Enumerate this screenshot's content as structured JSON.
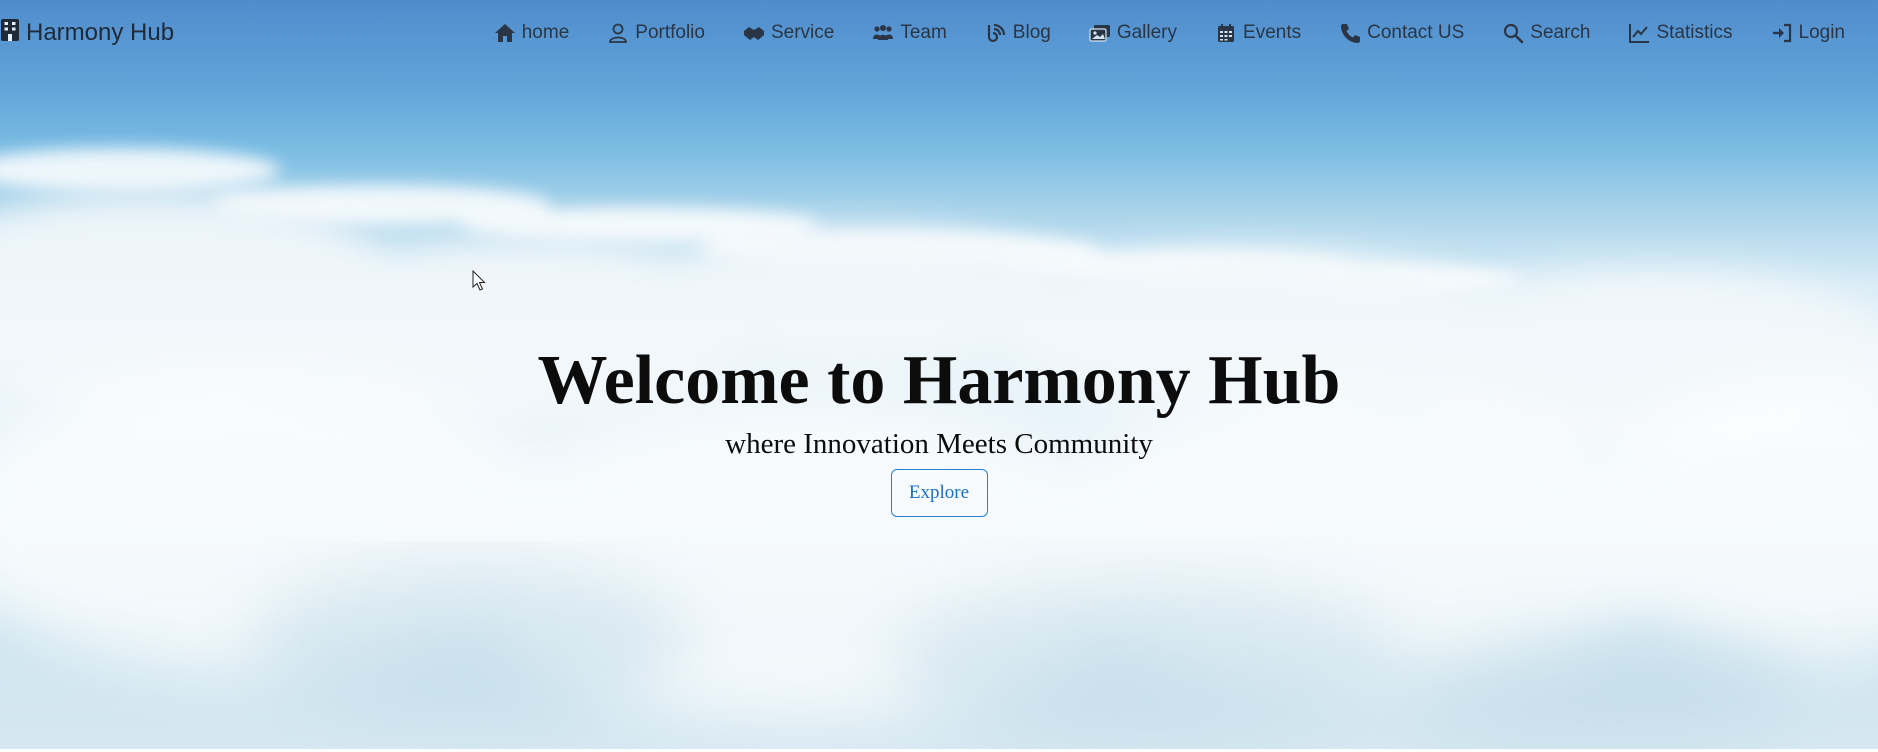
{
  "brand": {
    "icon": "building-icon",
    "name": "Harmony Hub"
  },
  "nav": {
    "items": [
      {
        "icon": "house-icon",
        "label": "home"
      },
      {
        "icon": "user-icon",
        "label": "Portfolio"
      },
      {
        "icon": "handshake-icon",
        "label": "Service"
      },
      {
        "icon": "people-group-icon",
        "label": "Team"
      },
      {
        "icon": "blog-icon",
        "label": "Blog"
      },
      {
        "icon": "images-icon",
        "label": "Gallery"
      },
      {
        "icon": "calendar-icon",
        "label": "Events"
      },
      {
        "icon": "phone-icon",
        "label": "Contact US"
      },
      {
        "icon": "search-icon",
        "label": "Search"
      },
      {
        "icon": "line-chart-icon",
        "label": "Statistics"
      },
      {
        "icon": "sign-in-icon",
        "label": "Login"
      }
    ]
  },
  "hero": {
    "title": "Welcome to Harmony Hub",
    "subtitle": "where Innovation Meets Community",
    "explore_label": "Explore"
  },
  "colors": {
    "sky_top": "#4f8ccd",
    "cloud": "#e8f3f9",
    "accent": "#1b6fc7",
    "text": "#0c0c0c",
    "nav_text": "#2a3646"
  }
}
